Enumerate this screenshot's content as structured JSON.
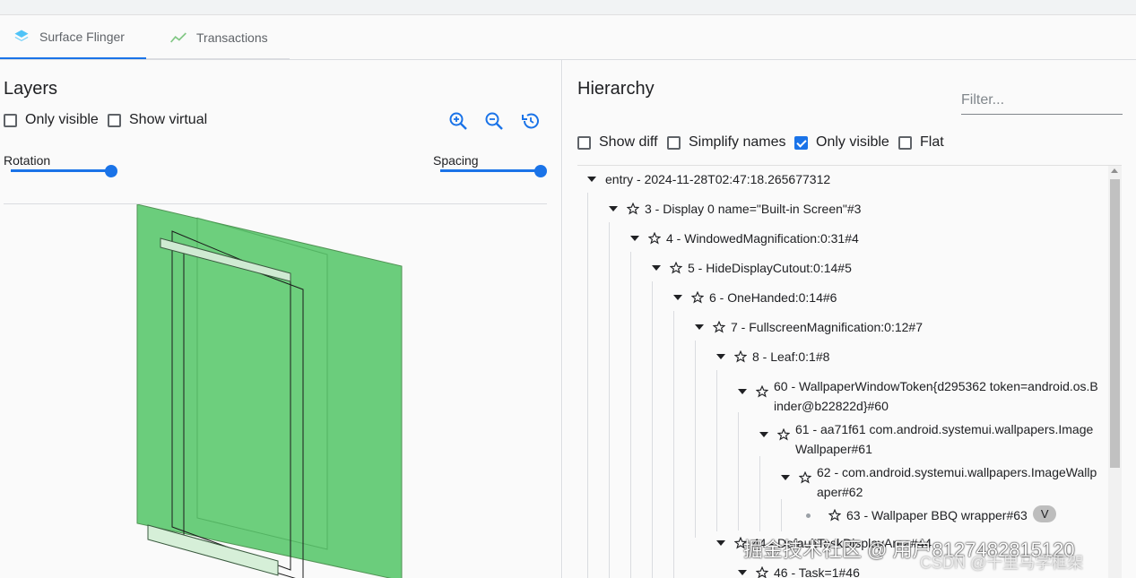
{
  "tabs": [
    {
      "label": "Surface Flinger",
      "icon": "layers-icon",
      "active": true
    },
    {
      "label": "Transactions",
      "icon": "trend-line-icon",
      "active": false
    }
  ],
  "layers": {
    "title": "Layers",
    "only_visible": {
      "label": "Only visible",
      "checked": false
    },
    "show_virtual": {
      "label": "Show virtual",
      "checked": false
    },
    "toolbar_icons": [
      "zoom-in-icon",
      "zoom-out-icon",
      "reset-view-icon"
    ],
    "rotation_label": "Rotation",
    "rotation_value": 1.0,
    "spacing_label": "Spacing",
    "spacing_value": 1.0
  },
  "hierarchy": {
    "title": "Hierarchy",
    "filter_placeholder": "Filter...",
    "show_diff": {
      "label": "Show diff",
      "checked": false
    },
    "simplify_names": {
      "label": "Simplify names",
      "checked": false
    },
    "only_visible": {
      "label": "Only visible",
      "checked": true
    },
    "flat": {
      "label": "Flat",
      "checked": false
    },
    "nodes": [
      {
        "text": "entry - 2024-11-28T02:47:18.265677312"
      },
      {
        "text": "3 - Display 0 name=\"Built-in Screen\"#3"
      },
      {
        "text": "4 - WindowedMagnification:0:31#4"
      },
      {
        "text": "5 - HideDisplayCutout:0:14#5"
      },
      {
        "text": "6 - OneHanded:0:14#6"
      },
      {
        "text": "7 - FullscreenMagnification:0:12#7"
      },
      {
        "text": "8 - Leaf:0:1#8"
      },
      {
        "text": "60 - WallpaperWindowToken{d295362 token=android.os.Binder@b22822d}#60"
      },
      {
        "text": "61 - aa71f61 com.android.systemui.wallpapers.ImageWallpaper#61"
      },
      {
        "text": "62 - com.android.systemui.wallpapers.ImageWallpaper#62"
      },
      {
        "text": "63 - Wallpaper BBQ wrapper#63",
        "chip": "V"
      },
      {
        "text": "44 - DefaultTaskDisplayArea#44"
      },
      {
        "text": "46 - Task=1#46"
      }
    ]
  },
  "watermark": {
    "main": "掘金技术社区 @ 用户8127482815120",
    "sub": "CSDN @千里马学框架"
  },
  "colors": {
    "accent": "#1a73e8",
    "layer_green": "#4cc461"
  }
}
